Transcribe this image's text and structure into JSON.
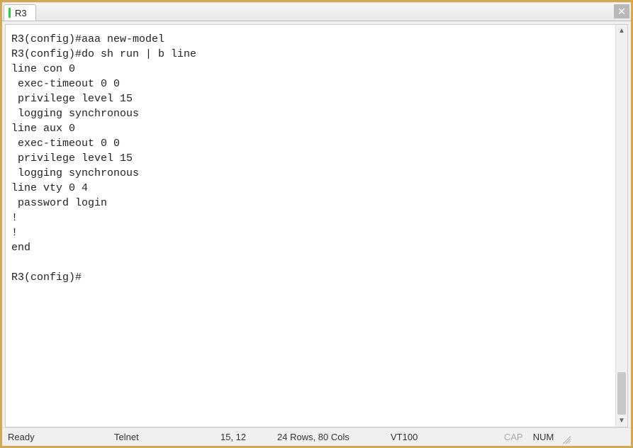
{
  "tab": {
    "label": "R3"
  },
  "terminal": {
    "lines": "R3(config)#aaa new-model\nR3(config)#do sh run | b line\nline con 0\n exec-timeout 0 0\n privilege level 15\n logging synchronous\nline aux 0\n exec-timeout 0 0\n privilege level 15\n logging synchronous\nline vty 0 4\n password login\n!\n!\nend\n\nR3(config)#"
  },
  "status": {
    "ready": "Ready",
    "connection": "Telnet",
    "cursor": "15, 12",
    "size": "24 Rows, 80 Cols",
    "term": "VT100",
    "cap": "CAP",
    "num": "NUM"
  }
}
